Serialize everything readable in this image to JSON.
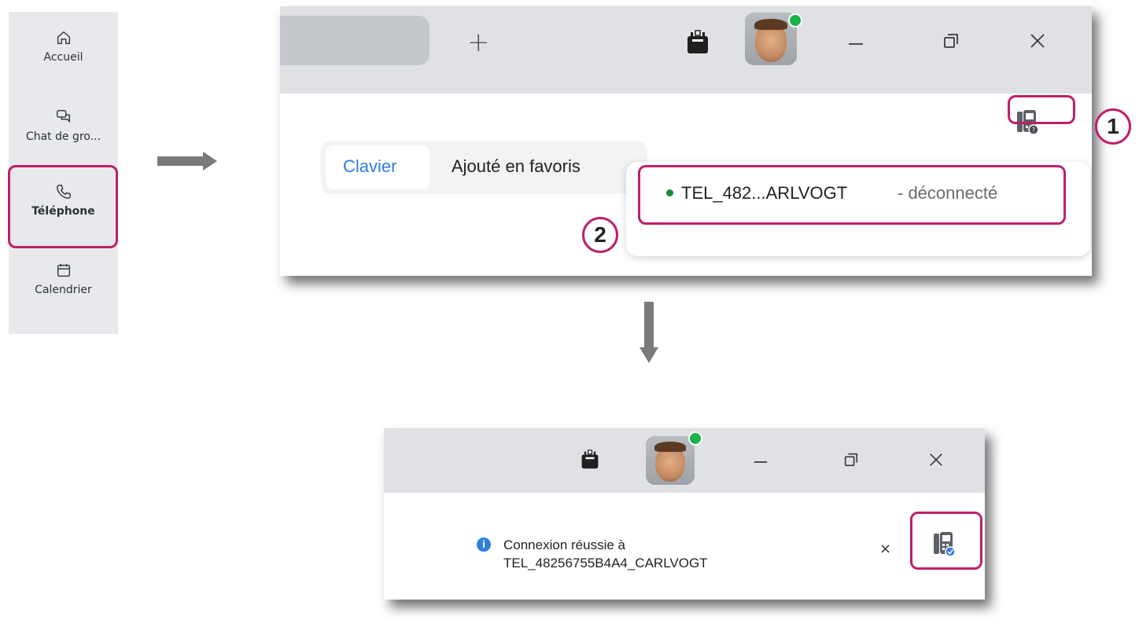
{
  "sidebar": {
    "items": [
      {
        "label": "Accueil",
        "icon": "home-icon"
      },
      {
        "label": "Chat de gro...",
        "icon": "chat-icon"
      },
      {
        "label": "Téléphone",
        "icon": "phone-icon"
      },
      {
        "label": "Calendrier",
        "icon": "calendar-icon"
      }
    ]
  },
  "window1": {
    "new_tab": "+",
    "tabs": {
      "keypad": "Clavier",
      "favorites": "Ajouté en favoris"
    },
    "device": {
      "name": "TEL_482...ARLVOGT",
      "status": "- déconnecté"
    },
    "callouts": {
      "step1": "1",
      "step2": "2"
    }
  },
  "window2": {
    "toast_line1": "Connexion réussie à",
    "toast_line2": "TEL_48256755B4A4_CARLVOGT",
    "toast_close": "×"
  },
  "colors": {
    "highlight": "#bf1f6b",
    "accent": "#2f7de1",
    "online": "#1bb44b"
  }
}
